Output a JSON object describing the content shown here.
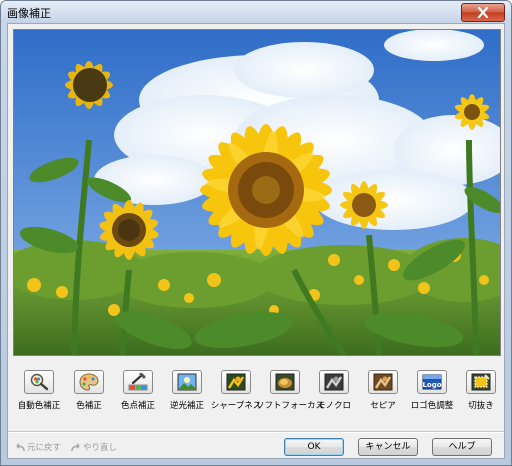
{
  "window": {
    "title": "画像補正"
  },
  "tools": [
    {
      "label": "自動色補正",
      "icon": "magnifier-color-icon"
    },
    {
      "label": "色補正",
      "icon": "palette-icon"
    },
    {
      "label": "色点補正",
      "icon": "eyedropper-icon"
    },
    {
      "label": "逆光補正",
      "icon": "backlight-photo-icon"
    },
    {
      "label": "シャープネス",
      "icon": "sharpness-icon"
    },
    {
      "label": "ソフトフォーカス",
      "icon": "soft-focus-icon"
    },
    {
      "label": "モノクロ",
      "icon": "monochrome-icon"
    },
    {
      "label": "セピア",
      "icon": "sepia-icon"
    },
    {
      "label": "ロゴ色調整",
      "icon": "logo-color-icon",
      "icon_text": "Logo"
    },
    {
      "label": "切抜き",
      "icon": "crop-icon"
    }
  ],
  "footer": {
    "undo_label": "元に戻す",
    "redo_label": "やり直し",
    "ok_label": "OK",
    "cancel_label": "キャンセル",
    "help_label": "ヘルプ"
  },
  "colors": {
    "sky": "#3f7fd0",
    "sunflower": "#f6c413",
    "foliage": "#4f8a2b"
  }
}
